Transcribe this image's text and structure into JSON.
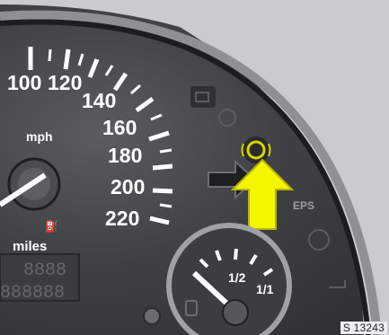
{
  "speedometer": {
    "tick_labels": [
      "100",
      "120",
      "140",
      "160",
      "180",
      "200",
      "220"
    ],
    "unit": "mph",
    "odometer_unit": "miles",
    "trip_display": "8888",
    "odometer_display": "888888"
  },
  "fuel_gauge": {
    "half_label": "1/2",
    "full_label": "1/1"
  },
  "warning_lights": {
    "eps_label": "EPS"
  },
  "figure_ref": "S 13243",
  "colors": {
    "arrow_yellow": "#f5f500",
    "lamp_yellow": "#d9d400",
    "dial_white": "#ffffff",
    "dash_light": "#c9cbcd"
  }
}
